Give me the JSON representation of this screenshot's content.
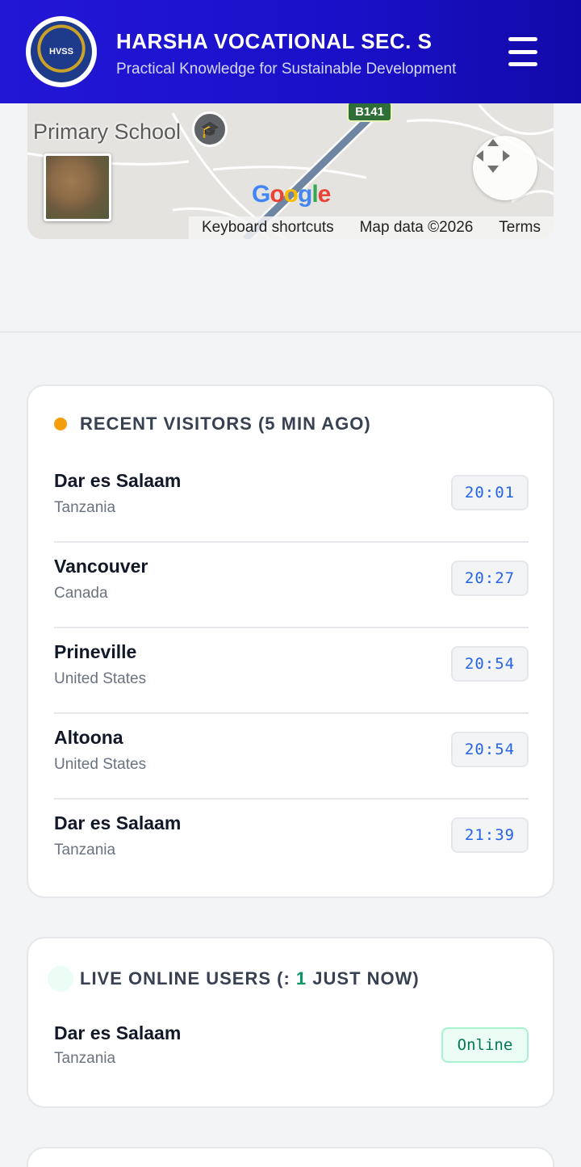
{
  "header": {
    "title": "HARSHA VOCATIONAL SEC. S",
    "subtitle": "Practical Knowledge for Sustainable Development",
    "logo_text": "HVSS"
  },
  "map": {
    "place_label": "Primary School",
    "road_label": "B141",
    "google_label": "Google",
    "footer_links": [
      "Keyboard shortcuts",
      "Map data ©2026",
      "Terms"
    ],
    "colors": {
      "google_blue": "#4285f4",
      "google_red": "#ea4335",
      "google_yellow": "#fbbc05",
      "google_green": "#34a853"
    }
  },
  "recent_visitors": {
    "title": "RECENT VISITORS (5 MIN AGO)",
    "items": [
      {
        "city": "Dar es Salaam",
        "country": "Tanzania",
        "time": "20:01"
      },
      {
        "city": "Vancouver",
        "country": "Canada",
        "time": "20:27"
      },
      {
        "city": "Prineville",
        "country": "United States",
        "time": "20:54"
      },
      {
        "city": "Altoona",
        "country": "United States",
        "time": "20:54"
      },
      {
        "city": "Dar es Salaam",
        "country": "Tanzania",
        "time": "21:39"
      }
    ]
  },
  "live_online": {
    "title_prefix": "LIVE ONLINE USERS (: ",
    "count": "1",
    "title_suffix": " JUST NOW)",
    "items": [
      {
        "city": "Dar es Salaam",
        "country": "Tanzania",
        "status": "Online"
      }
    ]
  },
  "colors": {
    "header_gradient_start": "#2317d6",
    "header_gradient_end": "#120aa8",
    "accent_orange": "#f59e0b",
    "time_blue": "#2563eb",
    "online_green": "#059669"
  }
}
